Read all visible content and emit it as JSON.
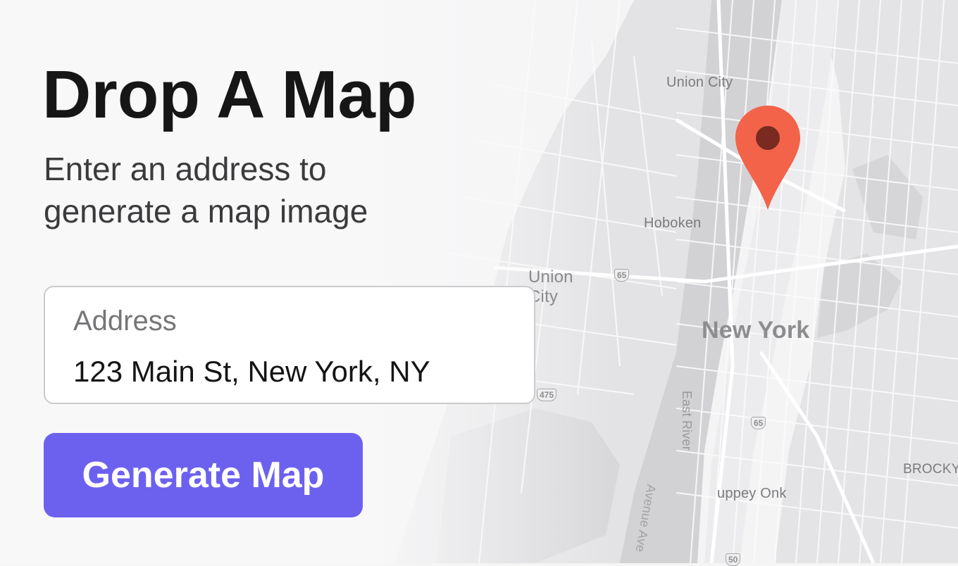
{
  "title": "Drop A Map",
  "subtitle": "Enter an address to\ngenerate a map image",
  "address": {
    "label": "Address",
    "value": "123 Main St, New York, NY"
  },
  "generate_button": {
    "label": "Generate Map"
  },
  "map": {
    "labels": {
      "union_city_top": "Union City",
      "hoboken": "Hoboken",
      "union_city_mid": "Union\nCity",
      "new_york": "New York",
      "east_river": "East River",
      "brooklyn": "BROCKY",
      "uppey_onk": "uppey Onk",
      "lower_rot": "Avenue Ave"
    },
    "shields": {
      "s65a": "65",
      "s75": "475",
      "s65b": "65",
      "s50": "50"
    },
    "pin_icon": "map-pin-icon"
  },
  "colors": {
    "accent": "#6c61ef",
    "pin": "#f2634a",
    "pin_center": "#7a2a20"
  }
}
